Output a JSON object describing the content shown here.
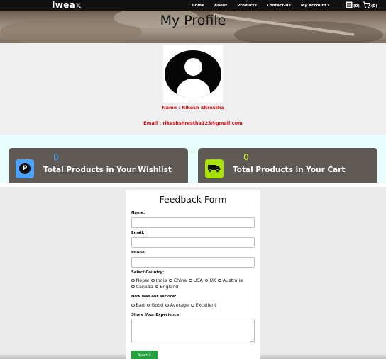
{
  "header": {
    "brand": "Iwea",
    "brand_mark": "𝕏",
    "nav": [
      "Home",
      "About",
      "Products",
      "Contact-Us",
      "My Account ▾"
    ],
    "list_count": "(0)",
    "cart_count": "(0)"
  },
  "banner": {
    "title": "My Profile"
  },
  "profile": {
    "name": "Name : Rikesh Shrestha",
    "email": "Email : rikeshshrestha123@gmail.com"
  },
  "stats": {
    "wishlist": {
      "count": "0",
      "label": "Total Products in Your Wishlist",
      "icon_letter": "P"
    },
    "cart": {
      "count": "0",
      "label": "Total Products in Your Cart"
    }
  },
  "feedback": {
    "title": "Feedback Form",
    "name_label": "Name:",
    "email_label": "Email:",
    "phone_label": "Phone:",
    "country_label": "Select Country:",
    "countries": [
      "Nepal",
      "India",
      "China",
      "USA",
      "UK",
      "Australia",
      "Canada",
      "England"
    ],
    "service_label": "How was our service:",
    "service_options": [
      "Bad",
      "Good",
      "Average",
      "Excellent"
    ],
    "experience_label": "Share Your Experience:",
    "submit": "Submit"
  },
  "colors": {
    "accent_red": "#d3121b",
    "wishlist_blue": "#4aa3ff",
    "cart_green": "#a8e400",
    "submit_green": "#21a03d"
  },
  "icons": [
    "list-icon",
    "cart-icon",
    "pinterest-icon",
    "truck-icon",
    "avatar-icon"
  ]
}
